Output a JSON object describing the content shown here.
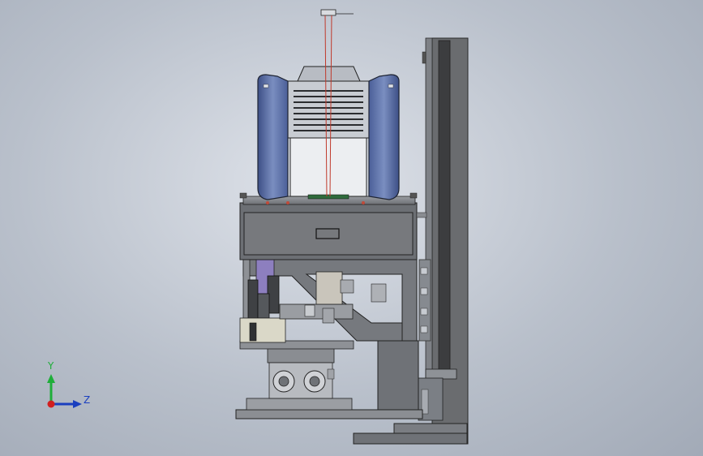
{
  "viewport": {
    "background_top": "#dfe3ea",
    "background_bottom": "#a2aab7"
  },
  "model": {
    "frame_color": "#5f6163",
    "plate_color": "#8f9297",
    "hood_color": "#4a5f93",
    "laser_color": "#c0392b"
  },
  "triad": {
    "y_label": "Y",
    "z_label": "Z",
    "y_color": "#1fae3a",
    "z_color": "#1a3fbf",
    "x_color": "#d11f1f",
    "icons": [
      "y-axis-arrow-icon",
      "z-axis-arrow-icon",
      "x-axis-dot-icon"
    ]
  }
}
